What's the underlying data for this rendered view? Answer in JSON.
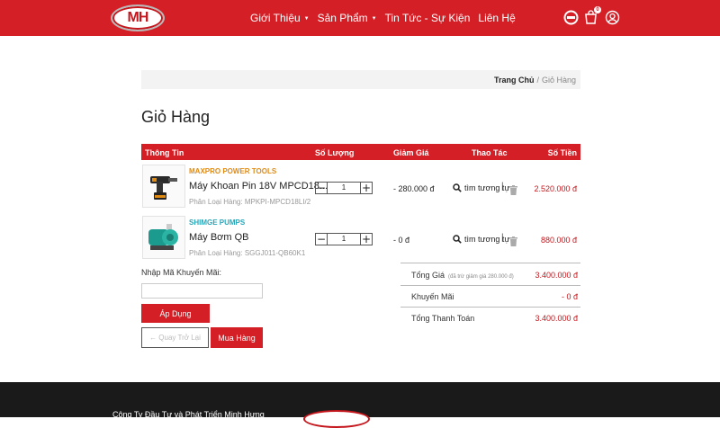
{
  "header": {
    "logo_text": "MH",
    "nav": [
      {
        "label": "Giới Thiệu",
        "has_caret": true
      },
      {
        "label": "Sản Phẩm",
        "has_caret": true
      },
      {
        "label": "Tin Tức - Sự Kiện",
        "has_caret": false
      },
      {
        "label": "Liên Hệ",
        "has_caret": false
      }
    ],
    "cart_count": "0",
    "icons": [
      "flag-icon",
      "cart-icon",
      "user-icon"
    ]
  },
  "breadcrumb": {
    "home": "Trang Chủ",
    "separator": "/",
    "current": "Giỏ Hàng"
  },
  "page_title": "Giỏ Hàng",
  "table": {
    "headers": {
      "info": "Thông Tin",
      "qty": "Số Lượng",
      "discount": "Giảm Giá",
      "actions": "Thao Tác",
      "amount": "Số Tiền"
    },
    "rows": [
      {
        "brand": "MAXPRO POWER TOOLS",
        "brand_color": "#e08a12",
        "name": "Máy Khoan Pin 18V MPCD18...",
        "variant": "Phân Loại Hàng: MPKPI-MPCD18LI/2",
        "qty": "1",
        "discount": "- 280.000 đ",
        "similar_label": "tìm tương tự",
        "price": "2.520.000 đ"
      },
      {
        "brand": "SHIMGE PUMPS",
        "brand_color": "#2aa6b7",
        "name": "Máy Bơm QB",
        "variant": "Phân Loại Hàng: SGGJ011-QB60K1",
        "qty": "1",
        "discount": "- 0 đ",
        "similar_label": "tìm tương tự",
        "price": "880.000 đ"
      }
    ]
  },
  "promo": {
    "label": "Nhập Mã Khuyến Mãi:",
    "placeholder": "",
    "apply": "Áp Dụng"
  },
  "buttons": {
    "back": "← Quay Trở Lại",
    "buy": "Mua Hàng"
  },
  "summary": {
    "total_label": "Tổng Giá",
    "total_note": "(đã trừ giảm giá 280.000 đ)",
    "total_value": "3.400.000 đ",
    "promo_label": "Khuyến Mãi",
    "promo_value": "- 0 đ",
    "pay_label": "Tổng Thanh Toán",
    "pay_value": "3.400.000 đ"
  },
  "footer": {
    "company": "Công Ty Đầu Tư và Phát Triển Minh Hưng"
  },
  "colors": {
    "brand_red": "#d51f26",
    "price_red": "#c4161c",
    "footer_bg": "#1a1a1a"
  }
}
